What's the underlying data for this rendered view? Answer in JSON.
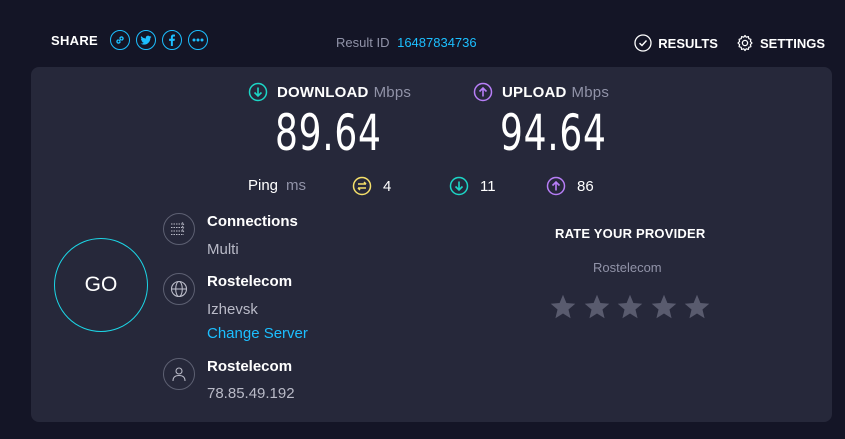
{
  "header": {
    "share_label": "SHARE",
    "result_id_label": "Result ID",
    "result_id_value": "16487834736",
    "results_label": "RESULTS",
    "settings_label": "SETTINGS"
  },
  "share_icons": [
    "link-icon",
    "twitter-icon",
    "facebook-icon",
    "more-icon"
  ],
  "download": {
    "label": "DOWNLOAD",
    "unit": "Mbps",
    "value": "89.64"
  },
  "upload": {
    "label": "UPLOAD",
    "unit": "Mbps",
    "value": "94.64"
  },
  "ping": {
    "label": "Ping",
    "unit": "ms",
    "idle": "4",
    "download": "11",
    "upload": "86"
  },
  "go_label": "GO",
  "connections": {
    "title": "Connections",
    "value": "Multi"
  },
  "server": {
    "title": "Rostelecom",
    "location": "Izhevsk",
    "change_label": "Change Server"
  },
  "provider": {
    "title": "Rostelecom",
    "ip": "78.85.49.192"
  },
  "rate": {
    "title": "RATE YOUR PROVIDER",
    "provider": "Rostelecom",
    "stars_total": 5,
    "stars_selected": 0
  },
  "colors": {
    "background": "#141526",
    "panel": "#26283a",
    "accent_blue": "#1cbfff",
    "download_teal": "#1cd6c6",
    "upload_purple": "#b77ef7",
    "ping_yellow": "#f5e06a",
    "muted": "#9193a8"
  }
}
